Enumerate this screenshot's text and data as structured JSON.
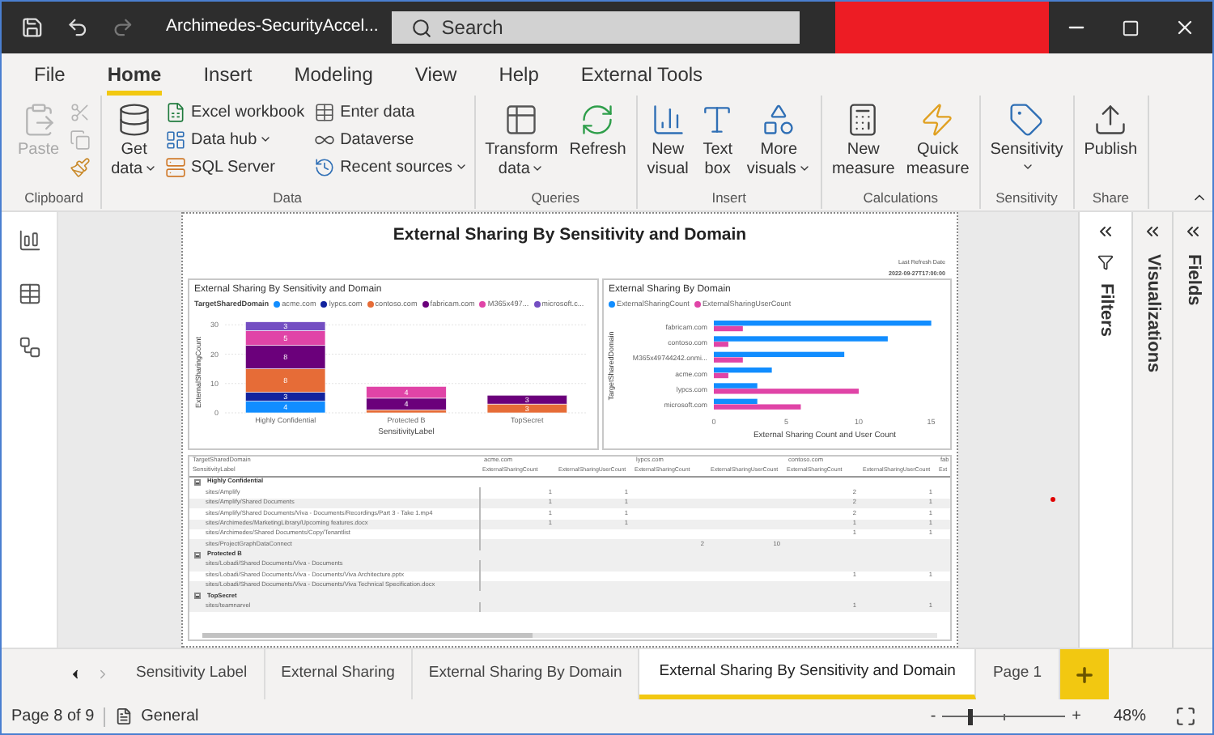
{
  "window": {
    "title": "Archimedes-SecurityAccel...",
    "search_placeholder": "Search"
  },
  "ribbon_tabs": [
    {
      "label": "File",
      "selected": false
    },
    {
      "label": "Home",
      "selected": true
    },
    {
      "label": "Insert",
      "selected": false
    },
    {
      "label": "Modeling",
      "selected": false
    },
    {
      "label": "View",
      "selected": false
    },
    {
      "label": "Help",
      "selected": false
    },
    {
      "label": "External Tools",
      "selected": false
    }
  ],
  "ribbon_groups": [
    {
      "label": "Clipboard",
      "items": [
        {
          "kind": "large",
          "label": "Paste",
          "menu": false,
          "disabled": true
        },
        {
          "kind": "icon",
          "disabled": true
        },
        {
          "kind": "icon",
          "disabled": true
        },
        {
          "kind": "icon",
          "disabled": false
        }
      ]
    },
    {
      "label": "Data",
      "items": [
        {
          "kind": "large",
          "label": "Get data",
          "menu": true,
          "disabled": false
        },
        {
          "kind": "small",
          "label": "Excel workbook",
          "menu": false,
          "disabled": false
        },
        {
          "kind": "small",
          "label": "Data hub",
          "menu": true,
          "disabled": false
        },
        {
          "kind": "small",
          "label": "SQL Server",
          "menu": false,
          "disabled": false
        },
        {
          "kind": "small",
          "label": "Enter data",
          "menu": false,
          "disabled": false
        },
        {
          "kind": "small",
          "label": "Dataverse",
          "menu": false,
          "disabled": false
        },
        {
          "kind": "small",
          "label": "Recent sources",
          "menu": true,
          "disabled": false
        }
      ]
    },
    {
      "label": "Queries",
      "items": [
        {
          "kind": "large",
          "label": "Transform data",
          "menu": true,
          "disabled": false
        },
        {
          "kind": "large",
          "label": "Refresh",
          "menu": false,
          "disabled": false
        }
      ]
    },
    {
      "label": "Insert",
      "items": [
        {
          "kind": "large",
          "label": "New visual",
          "menu": false,
          "disabled": false
        },
        {
          "kind": "large",
          "label": "Text box",
          "menu": false,
          "disabled": false
        },
        {
          "kind": "large",
          "label": "More visuals",
          "menu": true,
          "disabled": false
        }
      ]
    },
    {
      "label": "Calculations",
      "items": [
        {
          "kind": "large",
          "label": "New measure",
          "menu": false,
          "disabled": false
        },
        {
          "kind": "large",
          "label": "Quick measure",
          "menu": false,
          "disabled": false
        }
      ]
    },
    {
      "label": "Sensitivity",
      "items": [
        {
          "kind": "large",
          "label": "Sensitivity",
          "menu": true,
          "disabled": false
        }
      ]
    },
    {
      "label": "Share",
      "items": [
        {
          "kind": "large",
          "label": "Publish",
          "menu": false,
          "disabled": false
        }
      ]
    }
  ],
  "report": {
    "title": "External Sharing By Sensitivity and Domain",
    "refresh_label": "Last Refresh Date",
    "refresh_value": "2022-09-27T17:00:00",
    "left_chart": {
      "chart_data": {
        "type": "bar",
        "stacked": true,
        "title": "External Sharing By Sensitivity and Domain",
        "legend_title": "TargetSharedDomain",
        "xlabel": "SensitivityLabel",
        "ylabel": "ExternalSharingCount",
        "categories": [
          "Highly Confidential",
          "Protected B",
          "TopSecret"
        ],
        "grid": true,
        "ylim": [
          0,
          32
        ],
        "yticks": [
          0,
          10,
          20,
          30
        ],
        "series": [
          {
            "name": "acme.com",
            "color": "#118dff",
            "values": [
              4,
              null,
              null
            ],
            "value_labels": [
              "4",
              null,
              null
            ]
          },
          {
            "name": "lypcs.com",
            "color": "#12239e",
            "values": [
              3,
              null,
              null
            ],
            "value_labels": [
              "3",
              null,
              null
            ]
          },
          {
            "name": "contoso.com",
            "color": "#e66c37",
            "values": [
              8,
              1,
              3
            ],
            "value_labels": [
              "8",
              null,
              "3"
            ]
          },
          {
            "name": "fabricam.com",
            "color": "#6b007b",
            "values": [
              8,
              4,
              3
            ],
            "value_labels": [
              "8",
              "4",
              "3"
            ]
          },
          {
            "name": "M365x497...",
            "color": "#e044a7",
            "values": [
              5,
              4,
              null
            ],
            "value_labels": [
              "5",
              "4",
              null
            ]
          },
          {
            "name": "microsoft.c...",
            "color": "#744ec2",
            "values": [
              3,
              null,
              null
            ],
            "value_labels": [
              "3",
              null,
              null
            ]
          }
        ]
      }
    },
    "right_chart": {
      "chart_data": {
        "type": "bar",
        "orientation": "horizontal",
        "title": "External Sharing By Domain",
        "xlabel": "External Sharing Count and User Count",
        "ylabel": "TargetSharedDomain",
        "categories": [
          "fabricam.com",
          "contoso.com",
          "M365x49744242.onmi...",
          "acme.com",
          "lypcs.com",
          "microsoft.com"
        ],
        "xlim": [
          0,
          15.3
        ],
        "xticks": [
          0,
          5,
          10,
          15
        ],
        "series": [
          {
            "name": "ExternalSharingCount",
            "color": "#118dff",
            "values": [
              15,
              12,
              9,
              4,
              3,
              3
            ]
          },
          {
            "name": "ExternalSharingUserCount",
            "color": "#e044a7",
            "values": [
              2,
              1,
              2,
              1,
              10,
              6
            ]
          }
        ]
      }
    },
    "matrix": {
      "corner_top": "TargetSharedDomain",
      "corner_bottom": "SensitivityLabel",
      "domains": [
        "acme.com",
        "lypcs.com",
        "contoso.com",
        "fab"
      ],
      "measures": [
        "ExternalSharingCount",
        "ExternalSharingUserCount",
        "ExternalSharingCount",
        "ExternalSharingUserCount",
        "ExternalSharingCount",
        "ExternalSharingUserCount",
        "Ext"
      ],
      "groups": [
        {
          "label": "Highly Confidential",
          "expanded": true,
          "rows": [
            {
              "label": "sites/Amplify",
              "acme_count": "1",
              "acme_user_count": "1",
              "contoso_count": "2",
              "contoso_user_count": "1"
            },
            {
              "label": "sites/Amplify/Shared Documents",
              "acme_count": "1",
              "acme_user_count": "1",
              "contoso_count": "2",
              "contoso_user_count": "1"
            },
            {
              "label": "sites/Amplify/Shared Documents/Viva - Documents/Recordings/Part 3 - Take 1.mp4",
              "acme_count": "1",
              "acme_user_count": "1",
              "contoso_count": "2",
              "contoso_user_count": "1"
            },
            {
              "label": "sites/Archimedes/MarketingLibrary/Upcoming features.docx",
              "acme_count": "1",
              "acme_user_count": "1",
              "contoso_count": "1",
              "contoso_user_count": "1"
            },
            {
              "label": "sites/Archimedes/Shared Documents/Copy/Tenantlist",
              "contoso_count": "1",
              "contoso_user_count": "1"
            },
            {
              "label": "sites/ProjectGraphDataConnect",
              "lypcs_count": "2",
              "lypcs_user_count": "10"
            }
          ]
        },
        {
          "label": "Protected B",
          "expanded": true,
          "rows": [
            {
              "label": "sites/Lobadi/Shared Documents/Viva - Documents"
            },
            {
              "label": "sites/Lobadi/Shared Documents/Viva - Documents/Viva Architecture.pptx",
              "contoso_count": "1",
              "contoso_user_count": "1"
            },
            {
              "label": "sites/Lobadi/Shared Documents/Viva - Documents/Viva Technical Specification.docx"
            }
          ]
        },
        {
          "label": "TopSecret",
          "expanded": true,
          "rows": [
            {
              "label": "sites/teamnarvel",
              "contoso_count": "1",
              "contoso_user_count": "1"
            }
          ]
        }
      ]
    }
  },
  "panes": [
    {
      "label": "Filters"
    },
    {
      "label": "Visualizations"
    },
    {
      "label": "Fields"
    }
  ],
  "page_tabs": [
    {
      "label": "Sensitivity Label",
      "selected": false
    },
    {
      "label": "External Sharing",
      "selected": false
    },
    {
      "label": "External Sharing By Domain",
      "selected": false
    },
    {
      "label": "External Sharing By Sensitivity and Domain",
      "selected": true
    },
    {
      "label": "Page 1",
      "selected": false
    }
  ],
  "status_bar": {
    "page": "Page 8 of 9",
    "sensitivity": "General",
    "zoom": {
      "minus": "-",
      "plus": "+",
      "level": 0.22,
      "reading": "48%"
    }
  }
}
